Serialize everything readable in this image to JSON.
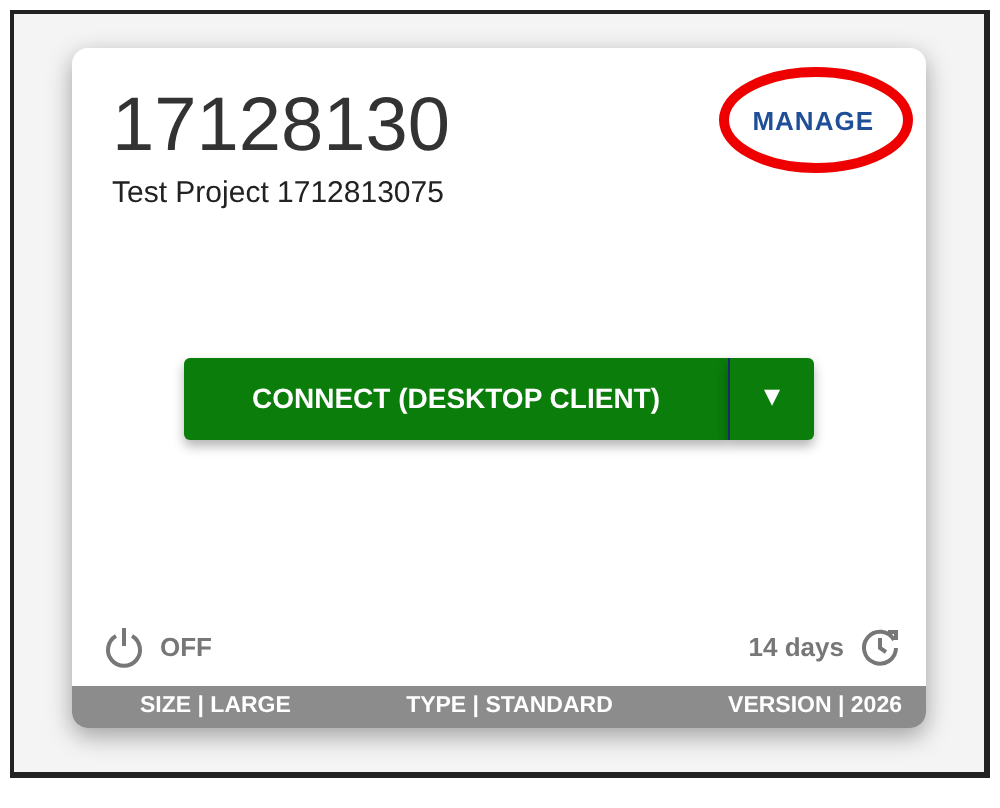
{
  "project": {
    "number": "17128130",
    "name": "Test Project 1712813075",
    "manage_link": "MANAGE"
  },
  "connect_button": {
    "label": "CONNECT (DESKTOP CLIENT)",
    "caret": "▾"
  },
  "status": {
    "power": "OFF",
    "expiry": "14 days"
  },
  "footer": [
    "SIZE | LARGE",
    "TYPE | STANDARD",
    "VERSION | 2026"
  ]
}
